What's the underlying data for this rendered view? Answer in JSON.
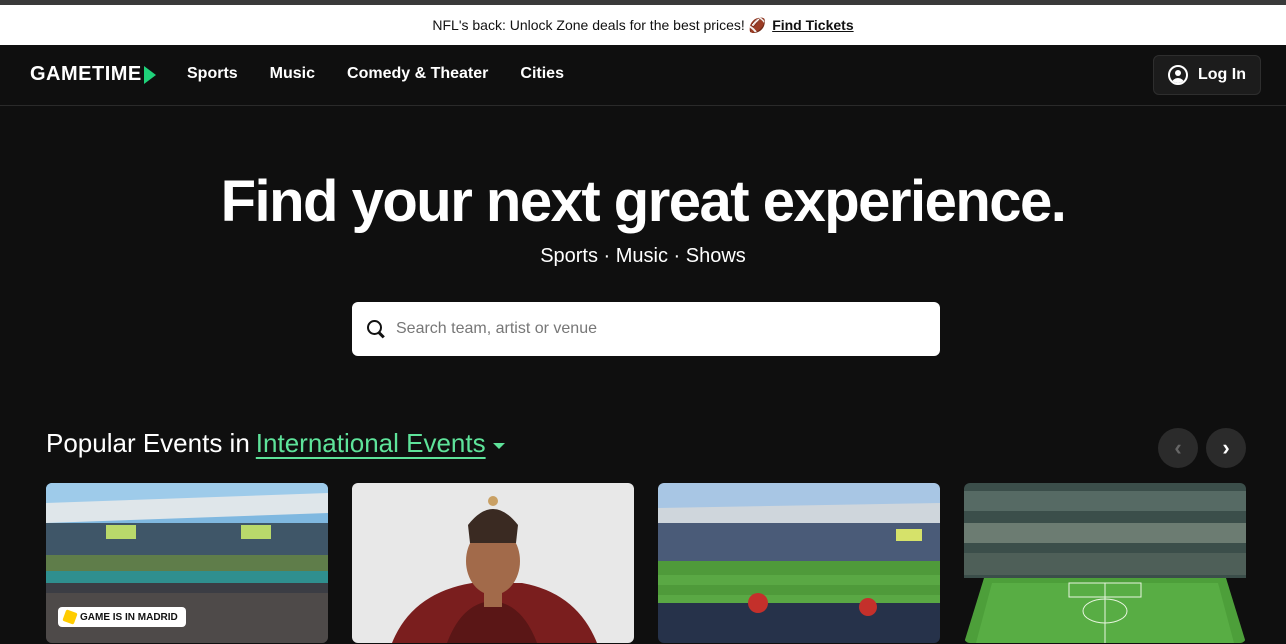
{
  "promo": {
    "text": "NFL's back: Unlock Zone deals for the best prices!",
    "emoji": "🏈",
    "link": "Find Tickets"
  },
  "nav": {
    "logo": "GAMETIME",
    "links": [
      "Sports",
      "Music",
      "Comedy & Theater",
      "Cities"
    ],
    "login": "Log In"
  },
  "hero": {
    "title": "Find your next great experience.",
    "subtitle": "Sports · Music · Shows"
  },
  "search": {
    "placeholder": "Search team, artist or venue"
  },
  "popular": {
    "prefix": "Popular Events in",
    "region": "International Events"
  },
  "cards": [
    {
      "badge": "GAME IS IN MADRID"
    }
  ],
  "colors": {
    "accent": "#1fd27a",
    "region": "#5ee39a",
    "background": "#0f0f0f"
  }
}
